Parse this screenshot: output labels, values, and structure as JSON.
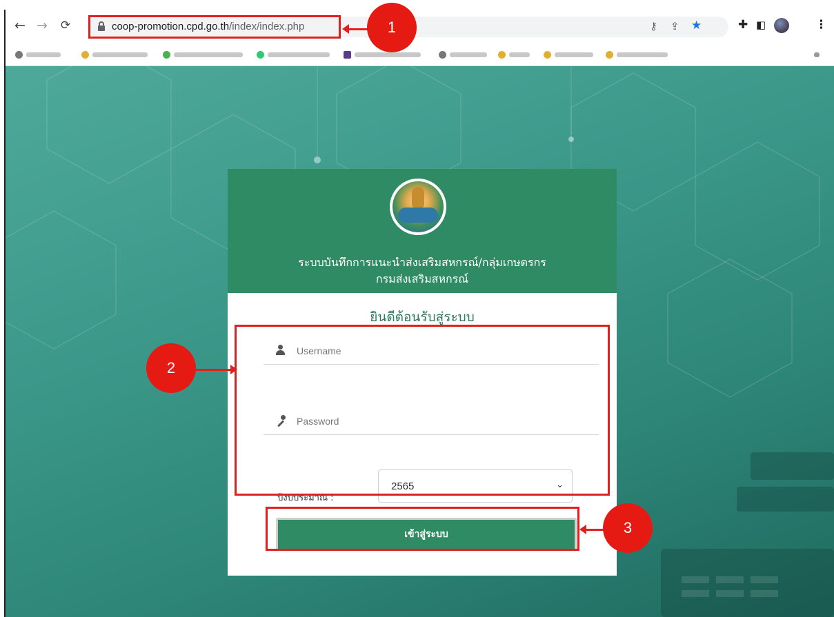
{
  "browser": {
    "url_host": "coop-promotion.cpd.go.th",
    "url_path": "/index/index.php"
  },
  "login": {
    "title_line1": "ระบบบันทึกการแนะนำส่งเสริมสหกรณ์/กลุ่มเกษตรกร",
    "title_line2": "กรมส่งเสริมสหกรณ์",
    "welcome": "ยินดีต้อนรับสู่ระบบ",
    "username_placeholder": "Username",
    "password_placeholder": "Password",
    "budget_year_label": "ปีงบประมาณ :",
    "budget_year_value": "2565",
    "submit_label": "เข้าสู่ระบบ"
  },
  "annotations": {
    "step1": "1",
    "step2": "2",
    "step3": "3",
    "color": "#e0201e"
  },
  "theme": {
    "brand_green": "#2e8b63",
    "heading_green": "#2e7b5a"
  }
}
